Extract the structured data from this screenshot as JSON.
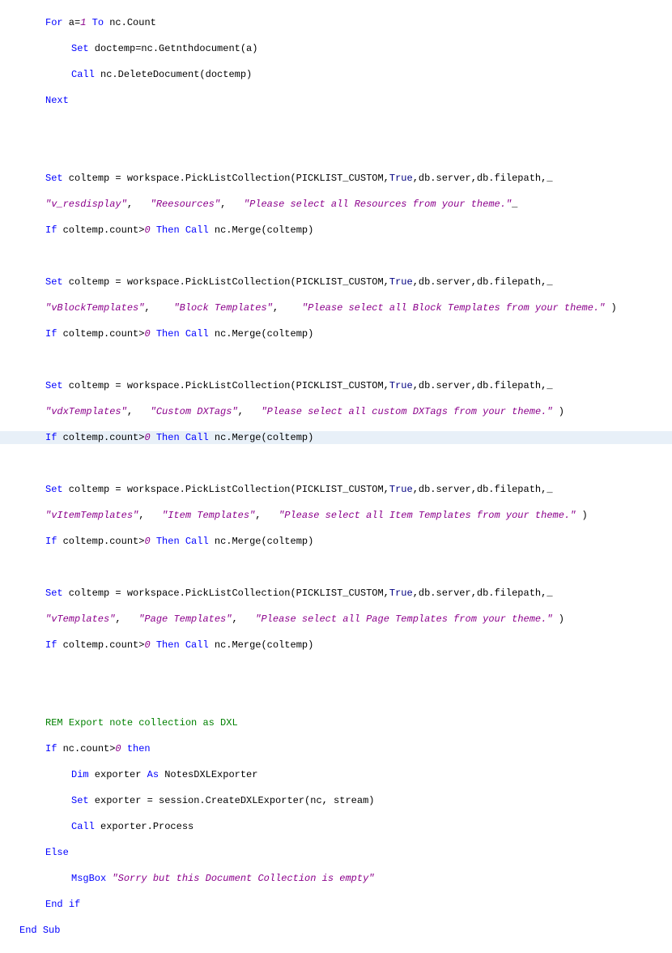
{
  "kw": {
    "For": "For",
    "To": "To",
    "Set": "Set",
    "Call": "Call",
    "Next": "Next",
    "If": "If",
    "Then": "Then",
    "True": "True",
    "REM": "REM",
    "then": "then",
    "Dim": "Dim",
    "As": "As",
    "Else": "Else",
    "MsgBox": "MsgBox",
    "End": "End",
    "if": "if",
    "Sub": "Sub"
  },
  "num": {
    "one": "1",
    "zero": "0"
  },
  "str": {
    "vres": "\"v_resdisplay\"",
    "resources": "\"Reesources\"",
    "selRes": "\"Please select all Resources from your theme.\"",
    "vblock": "\"vBlockTemplates\"",
    "block": "\"Block Templates\"",
    "selBlock": "\"Please select all Block Templates from your theme.\"",
    "vdx": "\"vdxTemplates\"",
    "dx": "\"Custom DXTags\"",
    "selDx": "\"Please select all custom DXTags from your theme.\"",
    "vitem": "\"vItemTemplates\"",
    "item": "\"Item Templates\"",
    "selItem": "\"Please select all Item Templates from your theme.\"",
    "vtemp": "\"vTemplates\"",
    "page": "\"Page Templates\"",
    "selPage": "\"Please select all Page Templates from your theme.\"",
    "sorry": "\"Sorry but this Document Collection is empty\""
  },
  "code": {
    "line1a": " a=",
    "line1b": " nc.Count",
    "line2": " doctemp=nc.Getnthdocument(a)",
    "line3": " nc.DeleteDocument(doctemp)",
    "pickList": " coltemp = workspace.PickListCollection(PICKLIST_CUSTOM,",
    "pickListEnd": ",db.server,db.filepath,_",
    "coltempCount": " coltemp.count>",
    "mergeCall": " nc.Merge(coltemp)",
    "comma": ",   ",
    "comma2": ",    ",
    "remComment": "Export note collection as DXL",
    "ncCount": " nc.count>",
    "exportAs": " exporter ",
    "notesDXL": " NotesDXLExporter",
    "createExp": " exporter = session.CreateDXLExporter(nc, stream)",
    "procCall": " exporter.Process",
    "closeParen": " )",
    "underscore": "_"
  }
}
